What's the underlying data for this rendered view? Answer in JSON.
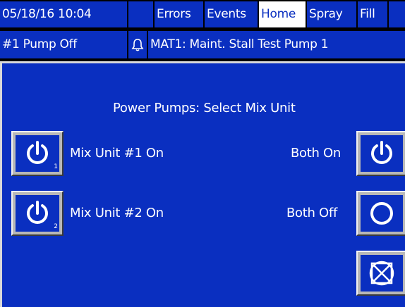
{
  "status_bar": {
    "datetime": "05/18/16 10:04",
    "tabs": [
      {
        "label": "Errors",
        "active": false
      },
      {
        "label": "Events",
        "active": false
      },
      {
        "label": "Home",
        "active": true
      },
      {
        "label": "Spray",
        "active": false
      },
      {
        "label": "Fill",
        "active": false
      }
    ],
    "pump_status": "#1 Pump Off",
    "alarm_icon": "bell-icon",
    "alarm_message": "MAT1: Maint. Stall Test Pump 1"
  },
  "main": {
    "title": "Power Pumps: Select Mix Unit",
    "options": [
      {
        "label": "Mix Unit #1 On",
        "icon": "power-icon",
        "subscript": "1"
      },
      {
        "label": "Mix Unit #2 On",
        "icon": "power-icon",
        "subscript": "2"
      },
      {
        "label": "Both On",
        "icon": "power-icon"
      },
      {
        "label": "Both Off",
        "icon": "off-circle-icon"
      },
      {
        "label": "",
        "icon": "cancel-icon"
      }
    ]
  },
  "colors": {
    "screen_blue": "#0a2fc0",
    "text_white": "#ffffff",
    "button_gray": "#b8b8b8",
    "active_tab": "#ffffff"
  }
}
